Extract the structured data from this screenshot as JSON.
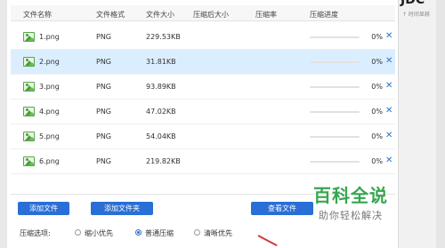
{
  "columns": {
    "name": "文件名称",
    "format": "文件格式",
    "size": "文件大小",
    "compressed_size": "压缩后大小",
    "ratio": "压缩率",
    "progress": "压缩进度"
  },
  "files": [
    {
      "name": "1.png",
      "format": "PNG",
      "size": "229.53KB",
      "compressed_size": "",
      "ratio": "",
      "progress_pct": "0%",
      "progress": 0,
      "selected": false
    },
    {
      "name": "2.png",
      "format": "PNG",
      "size": "31.81KB",
      "compressed_size": "",
      "ratio": "",
      "progress_pct": "0%",
      "progress": 0,
      "selected": true
    },
    {
      "name": "3.png",
      "format": "PNG",
      "size": "93.89KB",
      "compressed_size": "",
      "ratio": "",
      "progress_pct": "0%",
      "progress": 0,
      "selected": false
    },
    {
      "name": "4.png",
      "format": "PNG",
      "size": "47.02KB",
      "compressed_size": "",
      "ratio": "",
      "progress_pct": "0%",
      "progress": 0,
      "selected": false
    },
    {
      "name": "5.png",
      "format": "PNG",
      "size": "54.04KB",
      "compressed_size": "",
      "ratio": "",
      "progress_pct": "0%",
      "progress": 0,
      "selected": false
    },
    {
      "name": "6.png",
      "format": "PNG",
      "size": "219.82KB",
      "compressed_size": "",
      "ratio": "",
      "progress_pct": "0%",
      "progress": 0,
      "selected": false
    }
  ],
  "delete_glyph": "✕",
  "buttons": {
    "add_file": "添加文件",
    "add_folder": "添加文件夹",
    "view_files": "查看文件"
  },
  "compression": {
    "label": "压缩选项:",
    "options": [
      "缩小优先",
      "普通压缩",
      "清晰优先"
    ],
    "selected_index": 1
  },
  "watermark": {
    "main": "百科全说",
    "sub": "助你轻松解决"
  },
  "background": {
    "clipped_title": "JDC",
    "clipped_subtitle": "↑ 时间显赫"
  },
  "colors": {
    "accent": "#2a6fd6",
    "selected_row": "#dbeeff",
    "watermark_green": "#36a64f"
  },
  "icons": {
    "file": "image-file-icon",
    "delete": "close-icon"
  }
}
